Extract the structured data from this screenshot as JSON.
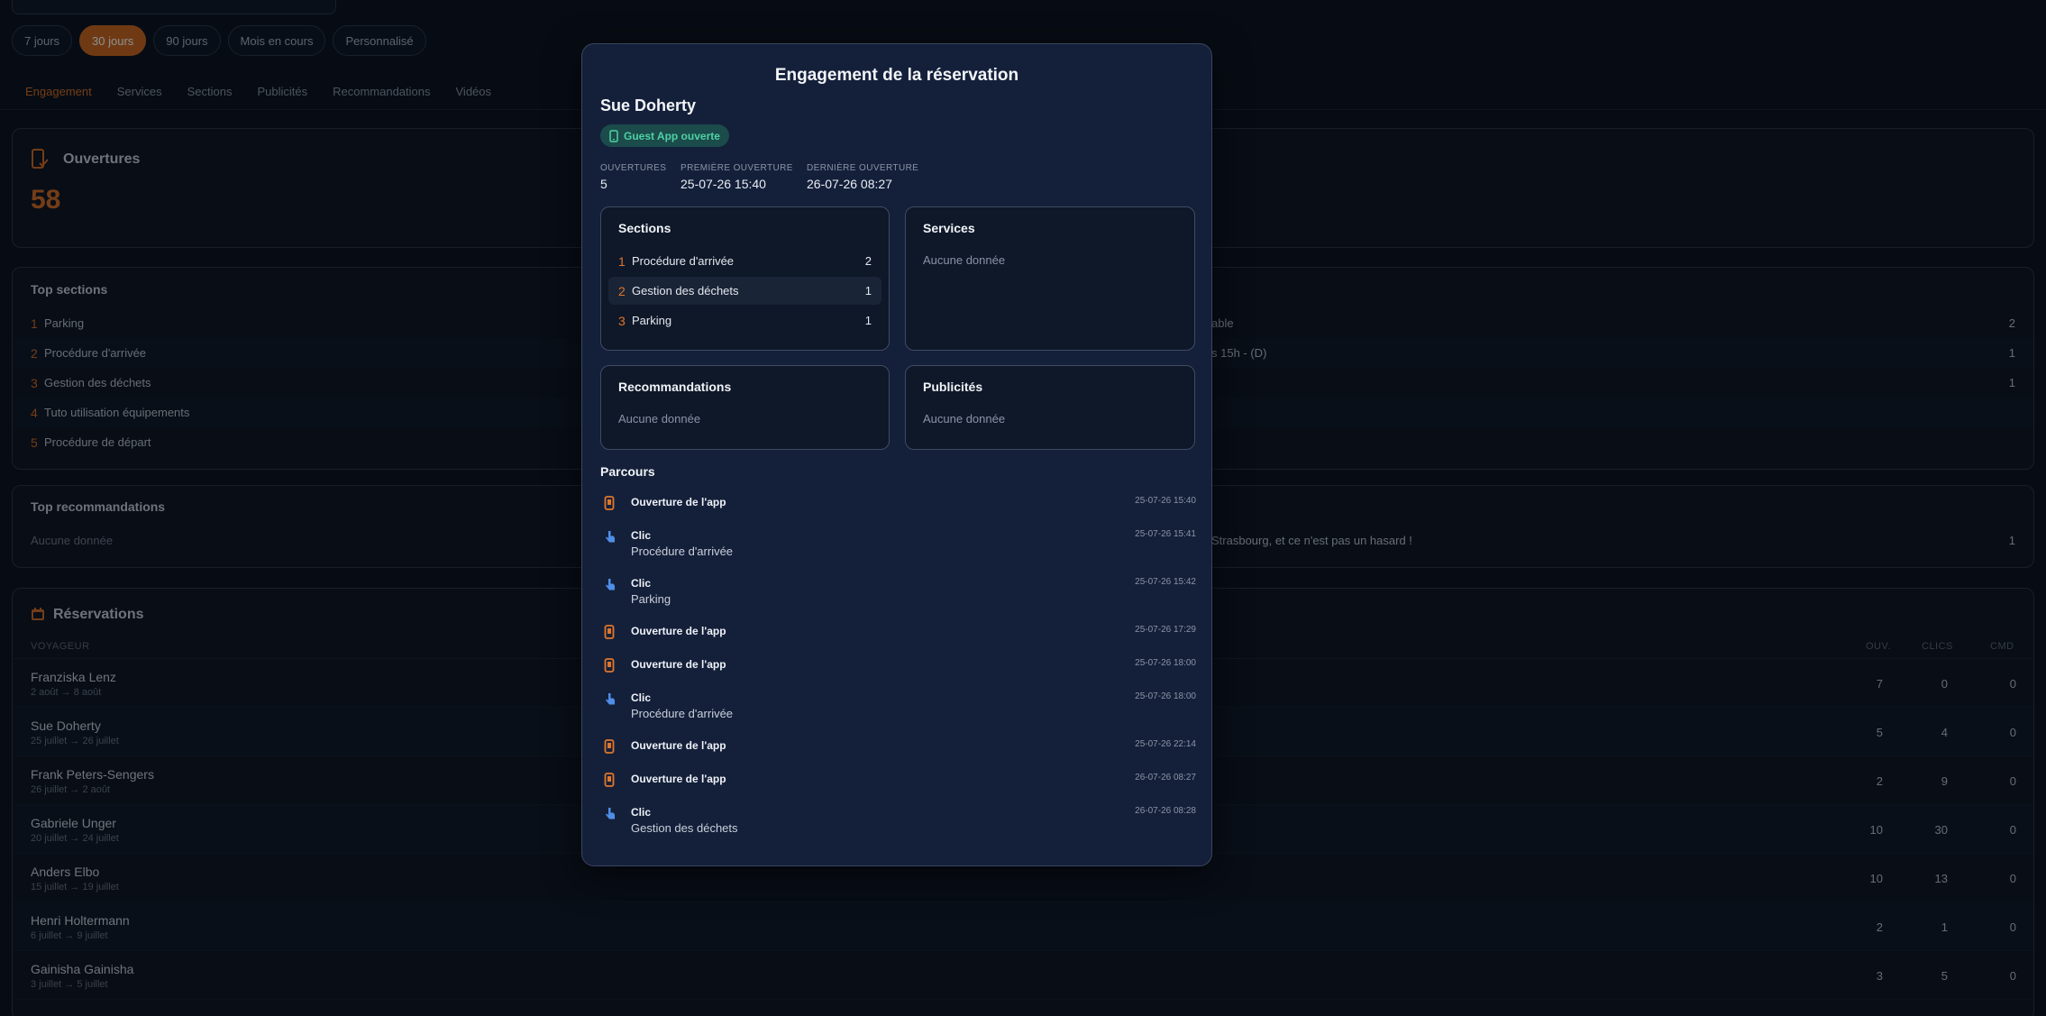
{
  "periods": [
    "7 jours",
    "30 jours",
    "90 jours",
    "Mois en cours",
    "Personnalisé"
  ],
  "tabs": [
    "Engagement",
    "Services",
    "Sections",
    "Publicités",
    "Recommandations",
    "Vidéos"
  ],
  "ouvertures": {
    "title": "Ouvertures",
    "value": "58"
  },
  "top_sections": {
    "title": "Top sections",
    "items": [
      {
        "rank": "1",
        "label": "Parking"
      },
      {
        "rank": "2",
        "label": "Procédure d'arrivée"
      },
      {
        "rank": "3",
        "label": "Gestion des déchets"
      },
      {
        "rank": "4",
        "label": "Tuto utilisation équipements"
      },
      {
        "rank": "5",
        "label": "Procédure de départ"
      }
    ],
    "right_items": [
      {
        "label": "able",
        "count": "2"
      },
      {
        "label": "s 15h - (D)",
        "count": "1"
      },
      {
        "label": "",
        "count": "1"
      }
    ]
  },
  "top_recommandations": {
    "title": "Top recommandations",
    "empty": "Aucune donnée",
    "right_text": "Strasbourg, et ce n'est pas un hasard !",
    "right_count": "1"
  },
  "reservations": {
    "title": "Réservations",
    "headers": {
      "voyageur": "VOYAGEUR",
      "ouv": "OUV.",
      "clics": "CLICS",
      "cmd": "CMD"
    },
    "rows": [
      {
        "name": "Franziska Lenz",
        "dates": "2 août → 8 août",
        "ouv": "7",
        "clics": "0",
        "cmd": "0"
      },
      {
        "name": "Sue Doherty",
        "dates": "25 juillet → 26 juillet",
        "ouv": "5",
        "clics": "4",
        "cmd": "0"
      },
      {
        "name": "Frank Peters-Sengers",
        "dates": "26 juillet → 2 août",
        "ouv": "2",
        "clics": "9",
        "cmd": "0"
      },
      {
        "name": "Gabriele Unger",
        "dates": "20 juillet → 24 juillet",
        "ouv": "10",
        "clics": "30",
        "cmd": "0"
      },
      {
        "name": "Anders Elbo",
        "dates": "15 juillet → 19 juillet",
        "ouv": "10",
        "clics": "13",
        "cmd": "0"
      },
      {
        "name": "Henri Holtermann",
        "dates": "6 juillet → 9 juillet",
        "ouv": "2",
        "clics": "1",
        "cmd": "0"
      },
      {
        "name": "Gainisha Gainisha",
        "dates": "3 juillet → 5 juillet",
        "ouv": "3",
        "clics": "5",
        "cmd": "0"
      }
    ]
  },
  "modal": {
    "title": "Engagement de la réservation",
    "guest": "Sue Doherty",
    "badge": "Guest App ouverte",
    "stats": [
      {
        "label": "OUVERTURES",
        "value": "5"
      },
      {
        "label": "PREMIÈRE OUVERTURE",
        "value": "25-07-26 15:40"
      },
      {
        "label": "DERNIÈRE OUVERTURE",
        "value": "26-07-26 08:27"
      }
    ],
    "sections": {
      "title": "Sections",
      "items": [
        {
          "rank": "1",
          "label": "Procédure d'arrivée",
          "count": "2"
        },
        {
          "rank": "2",
          "label": "Gestion des déchets",
          "count": "1"
        },
        {
          "rank": "3",
          "label": "Parking",
          "count": "1"
        }
      ]
    },
    "services": {
      "title": "Services",
      "empty": "Aucune donnée"
    },
    "recommandations": {
      "title": "Recommandations",
      "empty": "Aucune donnée"
    },
    "publicites": {
      "title": "Publicités",
      "empty": "Aucune donnée"
    },
    "parcours": {
      "title": "Parcours",
      "events": [
        {
          "type": "open",
          "title": "Ouverture de l'app",
          "sub": "",
          "time": "25-07-26 15:40"
        },
        {
          "type": "click",
          "title": "Clic",
          "sub": "Procédure d'arrivée",
          "time": "25-07-26 15:41"
        },
        {
          "type": "click",
          "title": "Clic",
          "sub": "Parking",
          "time": "25-07-26 15:42"
        },
        {
          "type": "open",
          "title": "Ouverture de l'app",
          "sub": "",
          "time": "25-07-26 17:29"
        },
        {
          "type": "open",
          "title": "Ouverture de l'app",
          "sub": "",
          "time": "25-07-26 18:00"
        },
        {
          "type": "click",
          "title": "Clic",
          "sub": "Procédure d'arrivée",
          "time": "25-07-26 18:00"
        },
        {
          "type": "open",
          "title": "Ouverture de l'app",
          "sub": "",
          "time": "25-07-26 22:14"
        },
        {
          "type": "open",
          "title": "Ouverture de l'app",
          "sub": "",
          "time": "26-07-26 08:27"
        },
        {
          "type": "click",
          "title": "Clic",
          "sub": "Gestion des déchets",
          "time": "26-07-26 08:28"
        }
      ]
    }
  }
}
